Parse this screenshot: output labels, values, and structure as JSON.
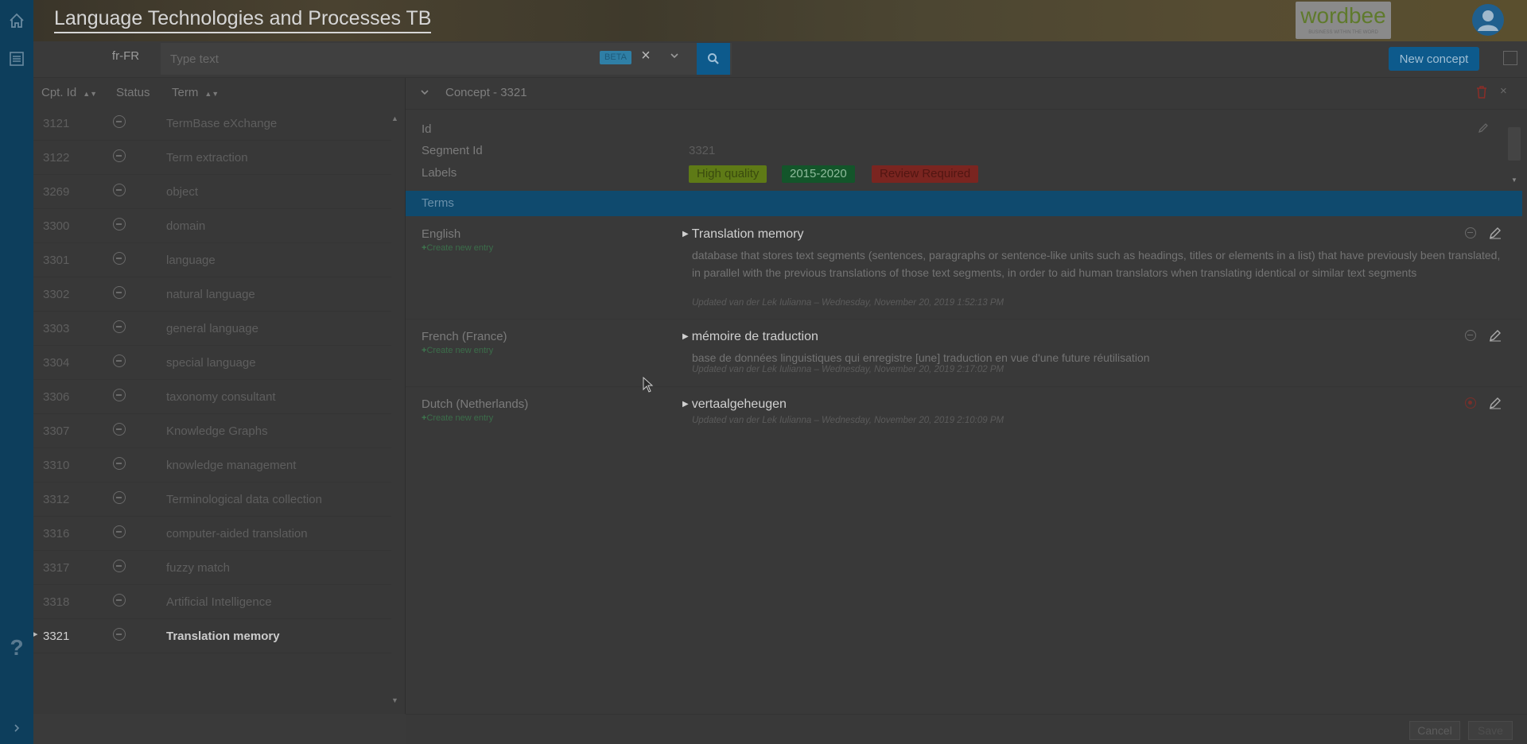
{
  "app": {
    "title": "Language Technologies and Processes TB"
  },
  "brand": {
    "name": "wordbee",
    "tagline": "BUSINESS WITHIN THE WORD"
  },
  "toolbar": {
    "language": "fr-FR",
    "search_placeholder": "Type text",
    "beta_badge": "BETA",
    "clear_label": "×",
    "new_concept_label": "New concept"
  },
  "list": {
    "headers": {
      "id": "Cpt. Id",
      "status": "Status",
      "term": "Term"
    },
    "rows": [
      {
        "id": "3121",
        "term": "TermBase eXchange"
      },
      {
        "id": "3122",
        "term": "Term extraction"
      },
      {
        "id": "3269",
        "term": "object"
      },
      {
        "id": "3300",
        "term": "domain"
      },
      {
        "id": "3301",
        "term": "language"
      },
      {
        "id": "3302",
        "term": "natural language"
      },
      {
        "id": "3303",
        "term": "general language"
      },
      {
        "id": "3304",
        "term": "special language"
      },
      {
        "id": "3306",
        "term": "taxonomy consultant"
      },
      {
        "id": "3307",
        "term": "Knowledge Graphs"
      },
      {
        "id": "3310",
        "term": "knowledge management"
      },
      {
        "id": "3312",
        "term": "Terminological data collection"
      },
      {
        "id": "3316",
        "term": "computer-aided translation"
      },
      {
        "id": "3317",
        "term": "fuzzy match"
      },
      {
        "id": "3318",
        "term": "Artificial Intelligence"
      },
      {
        "id": "3321",
        "term": "Translation memory"
      }
    ]
  },
  "concept": {
    "title": "Concept - 3321",
    "fields": {
      "id_label": "Id",
      "segment_label": "Segment Id",
      "segment_value": "3321",
      "labels_label": "Labels"
    },
    "tags": [
      "High quality",
      "2015-2020",
      "Review Required"
    ],
    "terms_header": "Terms",
    "create_new_entry": "Create new entry",
    "entries": [
      {
        "language": "English",
        "term": "Translation memory",
        "definition": "database that stores text segments (sentences, paragraphs or sentence-like units such as headings, titles or elements in a list) that have previously been translated, in parallel with the previous translations of those text segments, in order to aid human translators when translating identical or similar text segments",
        "updated": "Updated van der Lek Iulianna – Wednesday, November 20, 2019 1:52:13 PM"
      },
      {
        "language": "French (France)",
        "term": "mémoire de traduction",
        "definition": "base de données linguistiques qui enregistre [une] traduction en vue d'une future réutilisation",
        "updated": "Updated van der Lek Iulianna – Wednesday, November 20, 2019 2:17:02 PM"
      },
      {
        "language": "Dutch (Netherlands)",
        "term": "vertaalgeheugen",
        "definition": "",
        "updated": "Updated van der Lek Iulianna – Wednesday, November 20, 2019 2:10:09 PM"
      }
    ]
  },
  "footer": {
    "cancel_label": "Cancel",
    "save_label": "Save"
  },
  "colors": {
    "rail": "#0d3e5c",
    "accent": "#0d5a8c",
    "terms_bar": "#0f4a6e",
    "tag_green": "#5e7a16",
    "tag_darkgreen": "#13552a",
    "tag_red": "#7a2520"
  },
  "icons": {
    "home": "home-icon",
    "list": "list-icon",
    "help": "help-icon",
    "expand": "chevron-right-icon",
    "search": "search-icon",
    "user": "user-icon"
  }
}
